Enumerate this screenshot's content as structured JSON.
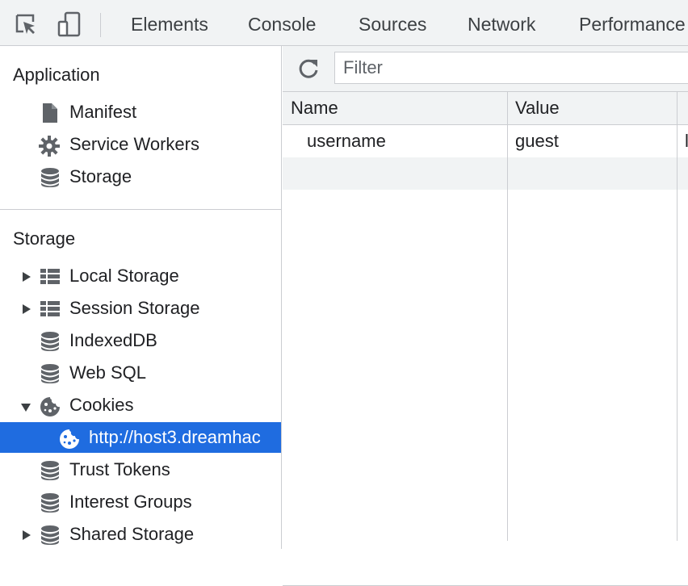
{
  "toolbar": {
    "tabs": [
      {
        "label": "Elements"
      },
      {
        "label": "Console"
      },
      {
        "label": "Sources"
      },
      {
        "label": "Network"
      },
      {
        "label": "Performance"
      }
    ]
  },
  "sidebar": {
    "application_title": "Application",
    "application_items": [
      {
        "label": "Manifest",
        "icon": "document-icon"
      },
      {
        "label": "Service Workers",
        "icon": "gear-icon"
      },
      {
        "label": "Storage",
        "icon": "database-icon"
      }
    ],
    "storage_title": "Storage",
    "storage_items": [
      {
        "label": "Local Storage",
        "icon": "table-icon",
        "expandable": true,
        "expanded": false
      },
      {
        "label": "Session Storage",
        "icon": "table-icon",
        "expandable": true,
        "expanded": false
      },
      {
        "label": "IndexedDB",
        "icon": "database-icon"
      },
      {
        "label": "Web SQL",
        "icon": "database-icon"
      },
      {
        "label": "Cookies",
        "icon": "cookie-icon",
        "expandable": true,
        "expanded": true
      },
      {
        "label": "http://host3.dreamhac",
        "icon": "cookie-icon",
        "selected": true
      },
      {
        "label": "Trust Tokens",
        "icon": "database-icon"
      },
      {
        "label": "Interest Groups",
        "icon": "database-icon"
      },
      {
        "label": "Shared Storage",
        "icon": "database-icon",
        "expandable": true,
        "expanded": false
      }
    ]
  },
  "main": {
    "filter": {
      "placeholder": "Filter",
      "value": ""
    },
    "columns": [
      "Name",
      "Value"
    ],
    "rows": [
      {
        "name": "username",
        "value": "guest"
      }
    ]
  },
  "colors": {
    "toolbar_bg": "#f1f3f4",
    "border": "#cbcdd1",
    "selected_bg": "#1f6ce0",
    "icon": "#5f6368"
  }
}
